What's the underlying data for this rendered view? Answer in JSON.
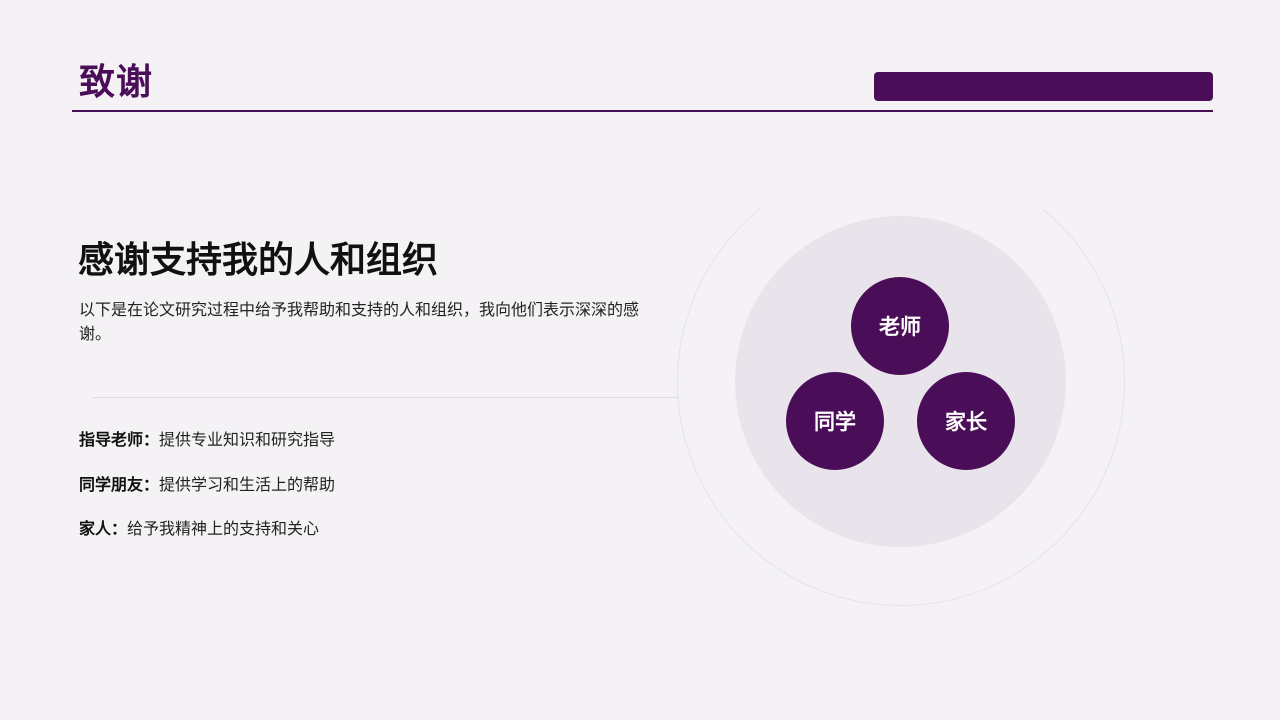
{
  "header": {
    "title": "致谢"
  },
  "main": {
    "heading": "感谢支持我的人和组织",
    "intro": "以下是在论文研究过程中给予我帮助和支持的人和组织，我向他们表示深深的感谢。",
    "items": [
      {
        "label": "指导老师：",
        "text": "提供专业知识和研究指导"
      },
      {
        "label": "同学朋友：",
        "text": "提供学习和生活上的帮助"
      },
      {
        "label": "家人：",
        "text": "给予我精神上的支持和关心"
      }
    ]
  },
  "diagram": {
    "circles": [
      "老师",
      "同学",
      "家长"
    ]
  },
  "colors": {
    "accent": "#4a0d57",
    "background": "#f4f2f5",
    "disc": "#e9e4eb"
  }
}
